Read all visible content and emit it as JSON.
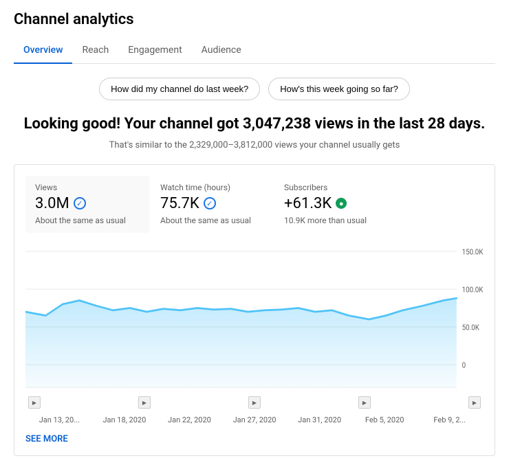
{
  "page": {
    "title": "Channel analytics"
  },
  "tabs": [
    {
      "label": "Overview",
      "active": true
    },
    {
      "label": "Reach",
      "active": false
    },
    {
      "label": "Engagement",
      "active": false
    },
    {
      "label": "Audience",
      "active": false
    }
  ],
  "quick_buttons": [
    {
      "label": "How did my channel do last week?"
    },
    {
      "label": "How's this week going so far?"
    }
  ],
  "hero": {
    "headline": "Looking good! Your channel got 3,047,238 views in the last 28 days.",
    "subtext": "That's similar to the 2,329,000–3,812,000 views your channel usually gets"
  },
  "stats": [
    {
      "label": "Views",
      "value": "3.0M",
      "icon": "check-circle",
      "icon_type": "blue",
      "note": "About the same as usual",
      "highlight": true
    },
    {
      "label": "Watch time (hours)",
      "value": "75.7K",
      "icon": "check-circle",
      "icon_type": "blue",
      "note": "About the same as usual",
      "highlight": false
    },
    {
      "label": "Subscribers",
      "value": "+61.3K",
      "icon": "plus-circle",
      "icon_type": "green",
      "note": "10.9K more than usual",
      "highlight": false
    }
  ],
  "chart": {
    "y_labels": [
      "150.0K",
      "100.0K",
      "50.0K",
      "0"
    ],
    "x_labels": [
      "Jan 13, 20...",
      "Jan 18, 2020",
      "Jan 22, 2020",
      "Jan 27, 2020",
      "Jan 31, 2020",
      "Feb 5, 2020",
      "Feb 9, 2..."
    ],
    "video_markers_count": 5
  },
  "see_more": {
    "label": "SEE MORE"
  }
}
